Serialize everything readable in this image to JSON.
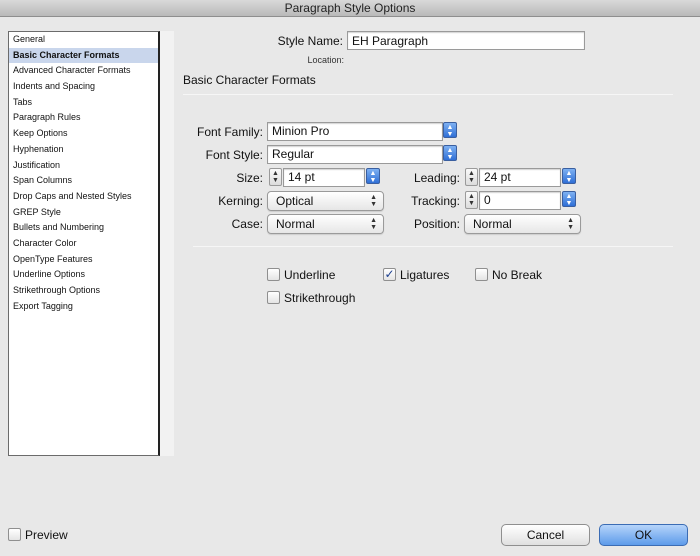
{
  "window": {
    "title": "Paragraph Style Options"
  },
  "sidebar": {
    "items": [
      {
        "label": "General",
        "selected": false
      },
      {
        "label": "Basic Character Formats",
        "selected": true
      },
      {
        "label": "Advanced Character Formats",
        "selected": false
      },
      {
        "label": "Indents and Spacing",
        "selected": false
      },
      {
        "label": "Tabs",
        "selected": false
      },
      {
        "label": "Paragraph Rules",
        "selected": false
      },
      {
        "label": "Keep Options",
        "selected": false
      },
      {
        "label": "Hyphenation",
        "selected": false
      },
      {
        "label": "Justification",
        "selected": false
      },
      {
        "label": "Span Columns",
        "selected": false
      },
      {
        "label": "Drop Caps and Nested Styles",
        "selected": false
      },
      {
        "label": "GREP Style",
        "selected": false
      },
      {
        "label": "Bullets and Numbering",
        "selected": false
      },
      {
        "label": "Character Color",
        "selected": false
      },
      {
        "label": "OpenType Features",
        "selected": false
      },
      {
        "label": "Underline Options",
        "selected": false
      },
      {
        "label": "Strikethrough Options",
        "selected": false
      },
      {
        "label": "Export Tagging",
        "selected": false
      }
    ]
  },
  "style": {
    "name_label": "Style Name:",
    "name_value": "EH Paragraph",
    "location_label": "Location:"
  },
  "section": {
    "title": "Basic Character Formats"
  },
  "fields": {
    "font_family_label": "Font Family:",
    "font_family_value": "Minion Pro",
    "font_style_label": "Font Style:",
    "font_style_value": "Regular",
    "size_label": "Size:",
    "size_value": "14 pt",
    "leading_label": "Leading:",
    "leading_value": "24 pt",
    "kerning_label": "Kerning:",
    "kerning_value": "Optical",
    "tracking_label": "Tracking:",
    "tracking_value": "0",
    "case_label": "Case:",
    "case_value": "Normal",
    "position_label": "Position:",
    "position_value": "Normal"
  },
  "options": {
    "underline": {
      "label": "Underline",
      "checked": false
    },
    "ligatures": {
      "label": "Ligatures",
      "checked": true
    },
    "no_break": {
      "label": "No Break",
      "checked": false
    },
    "strikethrough": {
      "label": "Strikethrough",
      "checked": false
    }
  },
  "footer": {
    "preview": {
      "label": "Preview",
      "checked": false
    },
    "cancel_label": "Cancel",
    "ok_label": "OK"
  },
  "colors": {
    "selection": "#c9d6ec",
    "accent": "#2f6fd6",
    "background": "#e8e8e8"
  },
  "icons": {
    "combo": "up-down-arrows-icon",
    "stepper": "stepper-arrows-icon",
    "check": "checkmark-icon"
  }
}
